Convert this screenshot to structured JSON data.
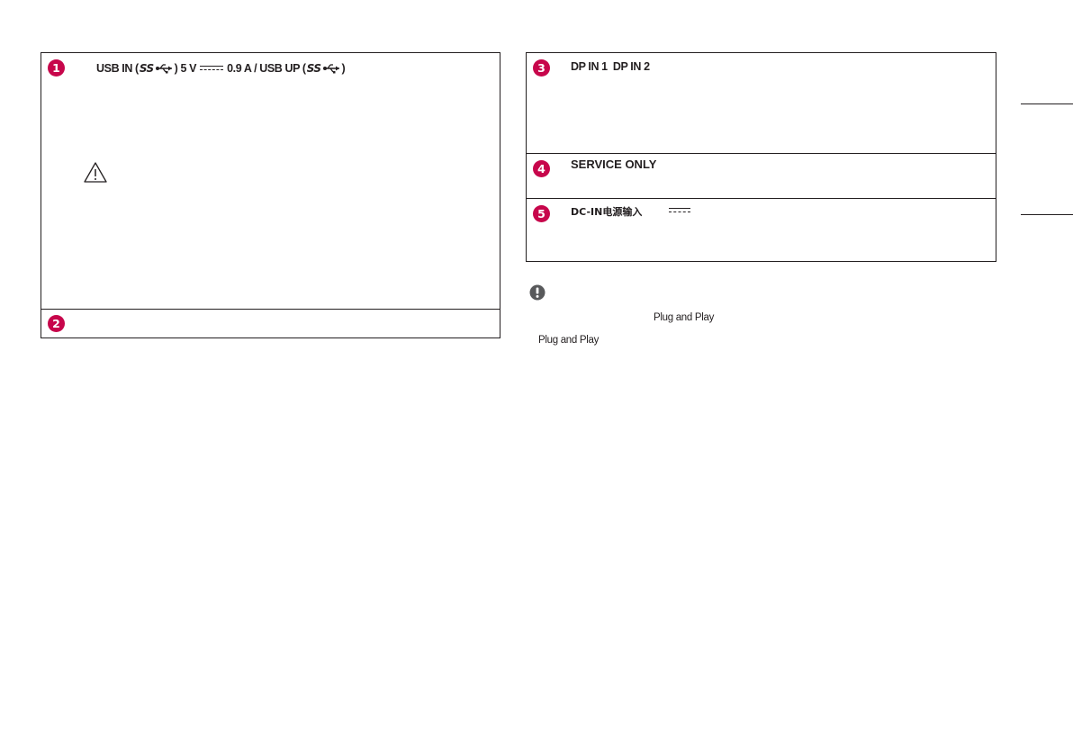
{
  "left_panel": {
    "item1": {
      "number": "1",
      "label_usb_in": "USB IN (",
      "ss_logo_a": "SS",
      "label_mid": ") 5 V",
      "label_current": "0.9 A / USB UP (",
      "ss_logo_b": "SS",
      "label_end": ")"
    },
    "item2": {
      "number": "2"
    }
  },
  "right_panel": {
    "item3": {
      "number": "3",
      "label": "DP IN 1  DP IN 2"
    },
    "item4": {
      "number": "4",
      "label": "SERVICE ONLY"
    },
    "item5": {
      "number": "5",
      "label": "DC-IN电源输入"
    }
  },
  "note": {
    "plug_and_play_1": "Plug and Play",
    "plug_and_play_2": "Plug and Play"
  },
  "colors": {
    "badge": "#c7064b",
    "text": "#231f20"
  }
}
